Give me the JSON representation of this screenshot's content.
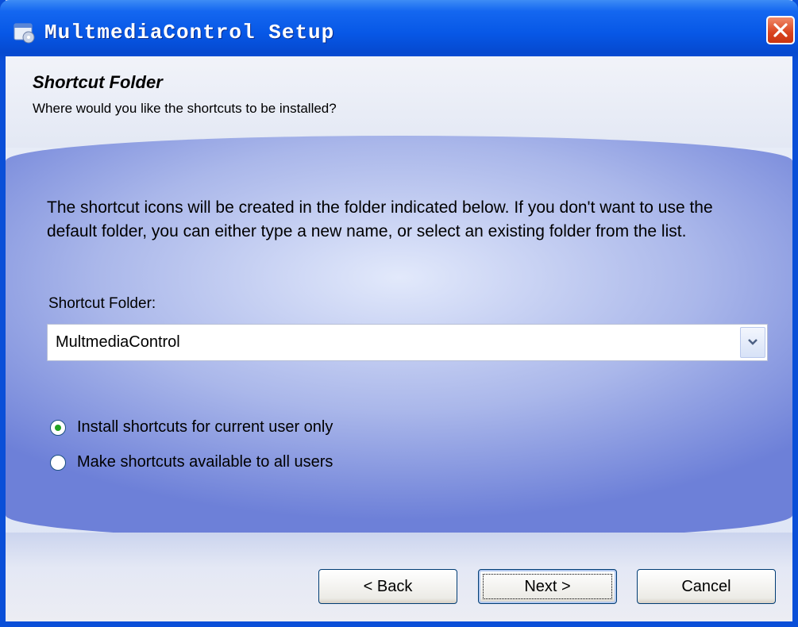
{
  "window": {
    "title": "MultmediaControl Setup",
    "icons": {
      "app": "installer-icon",
      "close": "close-icon"
    }
  },
  "header": {
    "title": "Shortcut Folder",
    "subtitle": "Where would you like the shortcuts to be installed?"
  },
  "body": {
    "description": "The shortcut icons will be created in the folder indicated below. If you don't want to use the default folder, you can either type a new name, or select an existing folder from the list.",
    "folder_label": "Shortcut Folder:",
    "folder_value": "MultmediaControl",
    "radio_current_user": "Install shortcuts for current user only",
    "radio_all_users": "Make shortcuts available to all users",
    "selected_radio": "current_user"
  },
  "buttons": {
    "back": "< Back",
    "next": "Next >",
    "cancel": "Cancel"
  },
  "colors": {
    "titlebar": "#0757e6",
    "close": "#d9431e",
    "radio_selected": "#21a121"
  }
}
